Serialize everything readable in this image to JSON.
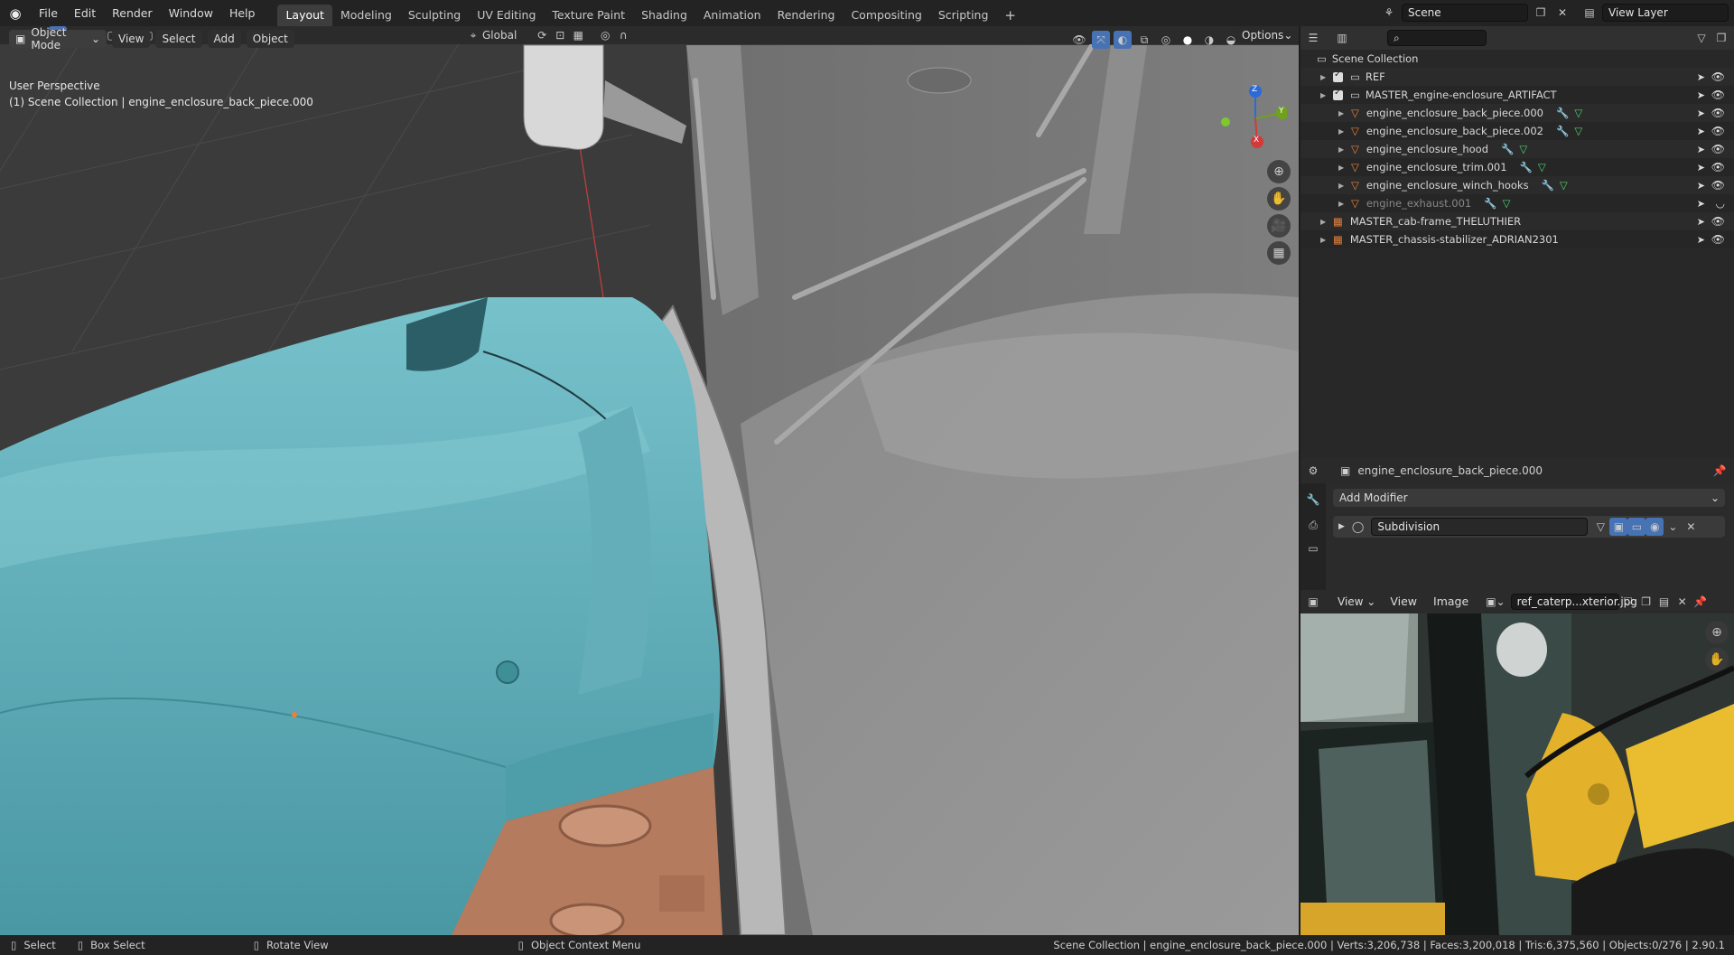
{
  "topbar": {
    "menus": [
      "File",
      "Edit",
      "Render",
      "Window",
      "Help"
    ],
    "workspaces": [
      "Layout",
      "Modeling",
      "Sculpting",
      "UV Editing",
      "Texture Paint",
      "Shading",
      "Animation",
      "Rendering",
      "Compositing",
      "Scripting"
    ],
    "active_workspace": "Layout",
    "scene": "Scene",
    "view_layer": "View Layer"
  },
  "viewport": {
    "mode": "Object Mode",
    "menus": [
      "View",
      "Select",
      "Add",
      "Object"
    ],
    "orientation": "Global",
    "options": "Options",
    "perspective": "User Perspective",
    "context": "(1) Scene Collection | engine_enclosure_back_piece.000",
    "gizmo": {
      "x": "X",
      "y": "Y",
      "z": "Z"
    }
  },
  "outliner": {
    "search_placeholder": "",
    "root": "Scene Collection",
    "rows": [
      {
        "label": "REF",
        "indent": 1,
        "type": "collection"
      },
      {
        "label": "MASTER_engine-enclosure_ARTIFACT",
        "indent": 1,
        "type": "collection"
      },
      {
        "label": "engine_enclosure_back_piece.000",
        "indent": 2,
        "type": "mesh"
      },
      {
        "label": "engine_enclosure_back_piece.002",
        "indent": 2,
        "type": "mesh"
      },
      {
        "label": "engine_enclosure_hood",
        "indent": 2,
        "type": "mesh"
      },
      {
        "label": "engine_enclosure_trim.001",
        "indent": 2,
        "type": "mesh"
      },
      {
        "label": "engine_enclosure_winch_hooks",
        "indent": 2,
        "type": "mesh"
      },
      {
        "label": "engine_exhaust.001",
        "indent": 2,
        "type": "mesh",
        "dim": true
      },
      {
        "label": "MASTER_cab-frame_THELUTHIER",
        "indent": 1,
        "type": "linked"
      },
      {
        "label": "MASTER_chassis-stabilizer_ADRIAN2301",
        "indent": 1,
        "type": "linked"
      }
    ]
  },
  "properties": {
    "object": "engine_enclosure_back_piece.000",
    "add_modifier": "Add Modifier",
    "modifier": "Subdivision"
  },
  "image_editor": {
    "menus": [
      "View",
      "View",
      "Image"
    ],
    "image": "ref_caterp...xterior.jpg"
  },
  "statusbar": {
    "select": "Select",
    "box_select": "Box Select",
    "rotate": "Rotate View",
    "context_menu": "Object Context Menu",
    "stats": "Scene Collection | engine_enclosure_back_piece.000 | Verts:3,206,738 | Faces:3,200,018 | Tris:6,375,560 | Objects:0/276 | 2.90.1"
  },
  "colors": {
    "accent": "#4772b3",
    "mesh": "#e8823a",
    "teal": "#5fa8b3"
  }
}
